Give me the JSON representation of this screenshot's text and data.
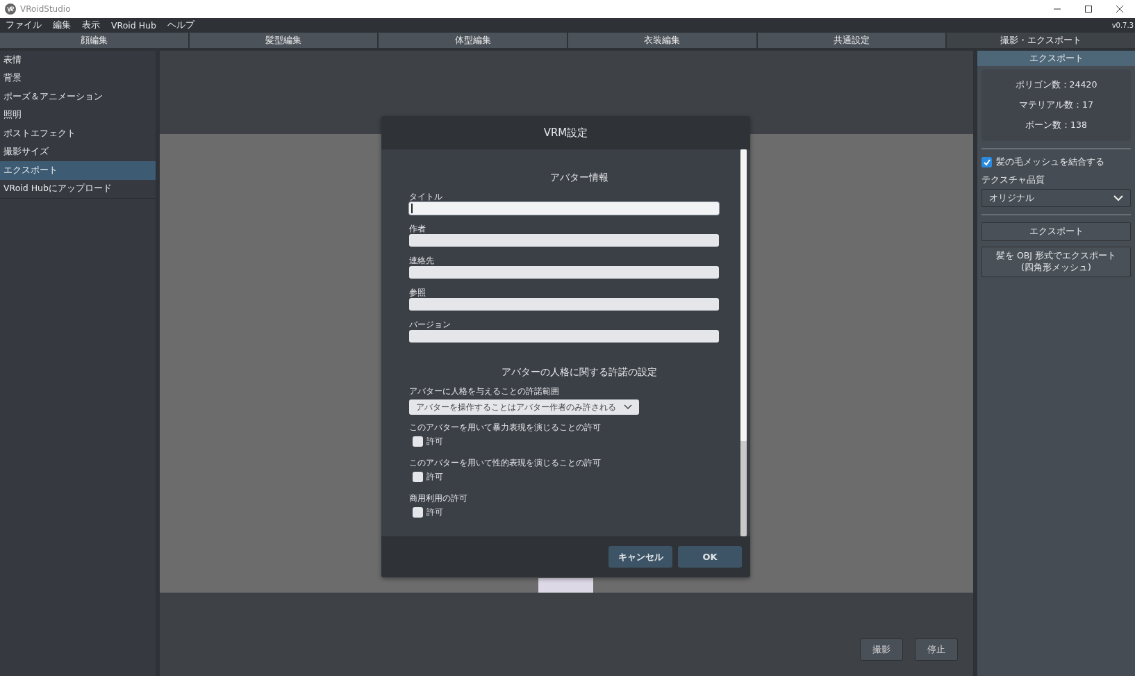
{
  "window": {
    "title": "VRoidStudio",
    "version": "v0.7.3"
  },
  "menu": [
    "ファイル",
    "編集",
    "表示",
    "VRoid Hub",
    "ヘルプ"
  ],
  "tabs": [
    {
      "label": "顔編集",
      "selected": false
    },
    {
      "label": "髪型編集",
      "selected": false
    },
    {
      "label": "体型編集",
      "selected": false
    },
    {
      "label": "衣装編集",
      "selected": false
    },
    {
      "label": "共通設定",
      "selected": false
    },
    {
      "label": "撮影・エクスポート",
      "selected": true
    }
  ],
  "sidebar": {
    "items": [
      {
        "label": "表情",
        "selected": false
      },
      {
        "label": "背景",
        "selected": false
      },
      {
        "label": "ポーズ＆アニメーション",
        "selected": false
      },
      {
        "label": "照明",
        "selected": false
      },
      {
        "label": "ポストエフェクト",
        "selected": false
      },
      {
        "label": "撮影サイズ",
        "selected": false
      },
      {
        "label": "エクスポート",
        "selected": true
      },
      {
        "label": "VRoid Hubにアップロード",
        "selected": false
      }
    ]
  },
  "dialog": {
    "title": "VRM設定",
    "info_heading": "アバター情報",
    "fields": [
      {
        "label": "タイトル",
        "focused": true
      },
      {
        "label": "作者",
        "focused": false
      },
      {
        "label": "連絡先",
        "focused": false
      },
      {
        "label": "参照",
        "focused": false
      },
      {
        "label": "バージョン",
        "focused": false
      }
    ],
    "permission_heading": "アバターの人格に関する許諾の設定",
    "scope": {
      "label": "アバターに人格を与えることの許諾範囲",
      "value": "アバターを操作することはアバター作者のみ許される"
    },
    "permissions": [
      {
        "label": "このアバターを用いて暴力表現を演じることの許可",
        "option": "許可",
        "checked": false
      },
      {
        "label": "このアバターを用いて性的表現を演じることの許可",
        "option": "許可",
        "checked": false
      },
      {
        "label": "商用利用の許可",
        "option": "許可",
        "checked": false
      }
    ],
    "buttons": [
      "キャンセル",
      "OK"
    ]
  },
  "right_panel": {
    "header": "エクスポート",
    "stats": [
      "ポリゴン数：24420",
      "マテリアル数：17",
      "ボーン数：138"
    ],
    "merge_hair": {
      "label": "髪の毛メッシュを結合する",
      "checked": true
    },
    "texture_quality": {
      "label": "テクスチャ品質",
      "value": "オリジナル"
    },
    "buttons": [
      "エクスポート",
      "髪を OBJ 形式でエクスポート\n(四角形メッシュ)"
    ]
  },
  "bottom_buttons": [
    "撮影",
    "停止"
  ]
}
